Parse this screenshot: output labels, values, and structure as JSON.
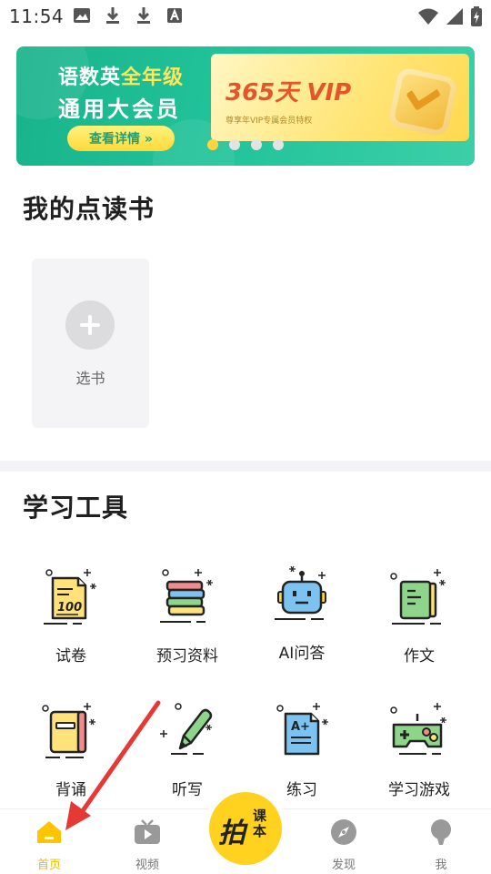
{
  "status_bar": {
    "time": "11:54"
  },
  "banner": {
    "line1_prefix": "语数英",
    "line1_highlight": "全年级",
    "line2": "通用大会员",
    "button_label": "查看详情 »",
    "card_title": "365天 VIP",
    "card_subtitle": "尊享年VIP专属会员特权",
    "dots_total": 4,
    "dots_active_index": 0
  },
  "reading_books": {
    "title": "我的点读书",
    "select_label": "选书"
  },
  "tools": {
    "title": "学习工具",
    "items": [
      {
        "label": "试卷",
        "icon": "exam-paper-icon"
      },
      {
        "label": "预习资料",
        "icon": "books-stack-icon"
      },
      {
        "label": "AI问答",
        "icon": "robot-icon"
      },
      {
        "label": "作文",
        "icon": "notebook-icon"
      },
      {
        "label": "背诵",
        "icon": "book-icon"
      },
      {
        "label": "听写",
        "icon": "pencil-icon"
      },
      {
        "label": "练习",
        "icon": "a-plus-sheet-icon"
      },
      {
        "label": "学习游戏",
        "icon": "gamepad-icon"
      }
    ]
  },
  "bottom_nav": {
    "items": [
      {
        "label": "首页",
        "icon": "home-icon",
        "active": true
      },
      {
        "label": "视频",
        "icon": "video-icon",
        "active": false
      },
      {
        "label": "发现",
        "icon": "compass-icon",
        "active": false
      },
      {
        "label": "我",
        "icon": "profile-icon",
        "active": false
      }
    ],
    "center_button": {
      "text_main": "拍",
      "text_side": "课本"
    }
  },
  "colors": {
    "accent_yellow": "#ffd21f",
    "banner_green": "#21c39a",
    "active_nav": "#f6b800",
    "annotation_red": "#e53935"
  }
}
